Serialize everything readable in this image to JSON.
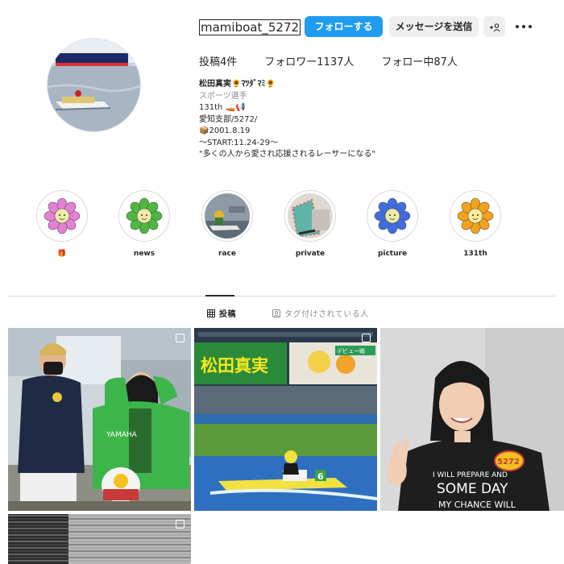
{
  "profile": {
    "username": "mamiboat_5272",
    "follow_label": "フォローする",
    "message_label": "メッセージを送信",
    "suggest_label": "+",
    "stats": {
      "posts": "投稿4件",
      "followers": "フォロワー1137人",
      "following": "フォロー中87人"
    },
    "bio": {
      "name": "松田真実🌻ﾏﾂﾀﾞﾏﾐ🌻",
      "category": "スポーツ選手",
      "line1": "131th 🚤📢",
      "line2": "愛知支部/5272/",
      "line3": "📦2001.8.19",
      "line4": "〜START:11.24-29〜",
      "line5": "\"多くの人から愛され応援されるレーサーになる\""
    }
  },
  "highlights": [
    {
      "label": "🎁",
      "icon": "pink-flower"
    },
    {
      "label": "news",
      "icon": "green-flower"
    },
    {
      "label": "race",
      "icon": "boat-photo"
    },
    {
      "label": "private",
      "icon": "private-photo"
    },
    {
      "label": "picture",
      "icon": "blue-flower"
    },
    {
      "label": "131th",
      "icon": "orange-flower"
    }
  ],
  "tabs": {
    "posts": "投稿",
    "tagged": "タグ付けされている人"
  },
  "posts": [
    {
      "type": "carousel",
      "icon": "paddock-photo"
    },
    {
      "type": "carousel",
      "icon": "race-banner-photo"
    },
    {
      "type": "single",
      "icon": "portrait-photo"
    },
    {
      "type": "carousel",
      "icon": "shutter-photo"
    }
  ],
  "post_texts": {
    "banner_name": "松田真実",
    "banner_tag": "デビュー戦",
    "boat_number": "6",
    "badge": "5272",
    "shirt_line1": "I WILL PREPARE AND",
    "shirt_line2": "SOME DAY",
    "shirt_line3": "MY CHANCE WILL"
  },
  "colors": {
    "accent": "#1f9cf0",
    "text": "#262626",
    "muted": "#8e8e8e",
    "divider": "#dbdbdb"
  }
}
